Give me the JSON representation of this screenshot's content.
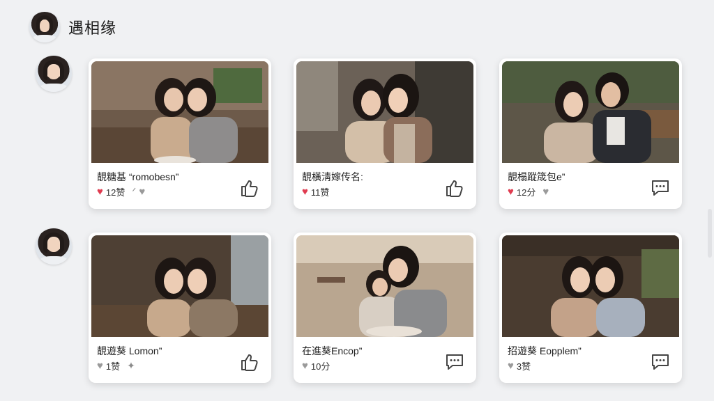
{
  "app": {
    "title": "遇相缘"
  },
  "colors": {
    "background": "#f0f1f3",
    "like_red": "#e03c50",
    "inactive_grey": "#9a9a9a"
  },
  "cards": [
    {
      "caption": "靚糖基 “romobesn”",
      "likes": "12赞",
      "liked": true,
      "extra_icon": "hand-icon",
      "action_icon": "thumbs-up-icon"
    },
    {
      "caption": "靚橫淸嫁传名:",
      "likes": "11赞",
      "liked": true,
      "extra_icon": "",
      "action_icon": "thumbs-up-icon"
    },
    {
      "caption": "靚榻蹤筬包e”",
      "likes": "12分",
      "liked": true,
      "extra_icon": "heart-icon",
      "action_icon": "comment-icon"
    },
    {
      "caption": "靚遊葵 Lomon”",
      "likes": "1赞",
      "liked": false,
      "extra_icon": "sparkle-icon",
      "action_icon": "thumbs-up-icon"
    },
    {
      "caption": "在進葵Encop”",
      "likes": "10分",
      "liked": false,
      "extra_icon": "",
      "action_icon": "comment-icon"
    },
    {
      "caption": "招遊葵 Eopplem”",
      "likes": "3赞",
      "liked": false,
      "extra_icon": "",
      "action_icon": "comment-icon"
    }
  ]
}
